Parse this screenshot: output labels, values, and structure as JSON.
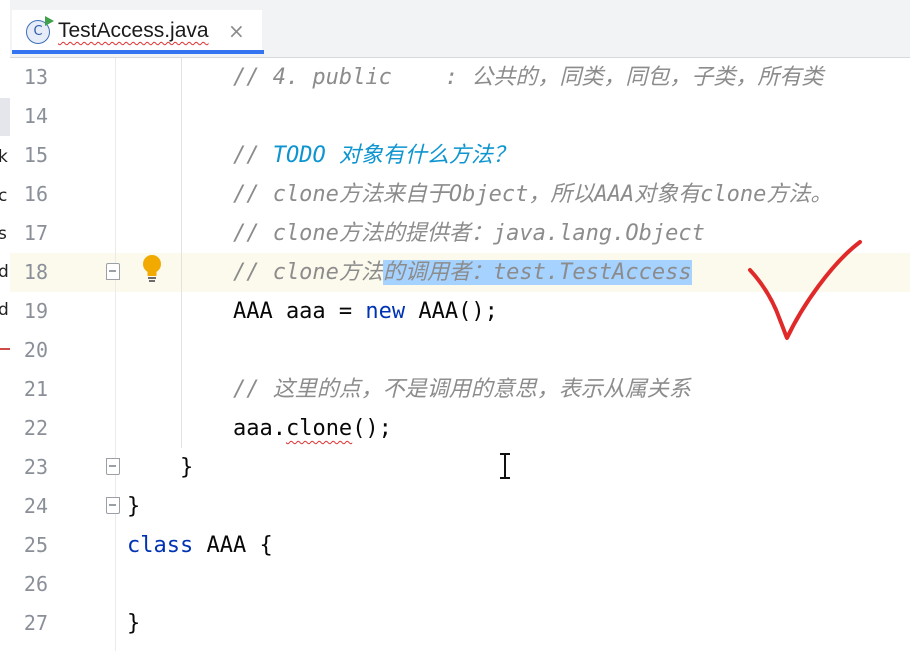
{
  "left_panel": {
    "visible_chars": [
      "k",
      "c",
      "s",
      "d",
      "d"
    ]
  },
  "tab": {
    "filename": "TestAccess.java",
    "icon_letter": "C",
    "close_glyph": "×"
  },
  "editor": {
    "lines": [
      {
        "n": "13",
        "parts": [
          {
            "t": "        // 4. public    : 公共的，同类，同包，子类，所有类",
            "c": "cmt"
          }
        ]
      },
      {
        "n": "14",
        "parts": []
      },
      {
        "n": "15",
        "parts": [
          {
            "t": "        // ",
            "c": "cmt"
          },
          {
            "t": "TODO 对象有什么方法？",
            "c": "todo"
          }
        ]
      },
      {
        "n": "16",
        "parts": [
          {
            "t": "        // clone方法来自于Object，所以AAA对象有clone方法。",
            "c": "cmt"
          }
        ]
      },
      {
        "n": "17",
        "parts": [
          {
            "t": "        // clone方法的提供者：java.lang.Object",
            "c": "cmt"
          }
        ]
      },
      {
        "n": "18",
        "parts": [
          {
            "t": "        // clone方法",
            "c": "cmt"
          },
          {
            "t": "的调用者：test.TestAccess",
            "c": "cmt sel-text"
          }
        ],
        "current": true
      },
      {
        "n": "19",
        "parts": [
          {
            "t": "        AAA aaa = ",
            "c": ""
          },
          {
            "t": "new",
            "c": "kw"
          },
          {
            "t": " AAA();",
            "c": ""
          }
        ]
      },
      {
        "n": "20",
        "parts": []
      },
      {
        "n": "21",
        "parts": [
          {
            "t": "        // 这里的点，不是调用的意思，表示从属关系",
            "c": "cmt"
          }
        ]
      },
      {
        "n": "22",
        "parts": [
          {
            "t": "        aaa.",
            "c": ""
          },
          {
            "t": "clone",
            "c": "squiggle"
          },
          {
            "t": "();",
            "c": ""
          }
        ]
      },
      {
        "n": "23",
        "parts": [
          {
            "t": "    }",
            "c": ""
          }
        ]
      },
      {
        "n": "24",
        "parts": [
          {
            "t": "}",
            "c": ""
          }
        ]
      },
      {
        "n": "25",
        "parts": [
          {
            "t": "class",
            "c": "kw"
          },
          {
            "t": " AAA {",
            "c": ""
          }
        ]
      },
      {
        "n": "26",
        "parts": []
      },
      {
        "n": "27",
        "parts": [
          {
            "t": "}",
            "c": ""
          }
        ]
      }
    ]
  },
  "colors": {
    "accent": "#3574f0",
    "keyword": "#0033b3",
    "comment": "#8c8c8c",
    "todo": "#0e95d0",
    "selection": "#a6d2ff",
    "current_line": "#fcfaed",
    "annotation_red": "#e02a2a",
    "bulb": "#f2a900"
  },
  "icons": {
    "class_file": "java-class-icon",
    "intention": "lightbulb-icon",
    "fold": "fold-marker-icon",
    "mouse": "ibeam-cursor-icon",
    "annotation": "red-checkmark"
  }
}
